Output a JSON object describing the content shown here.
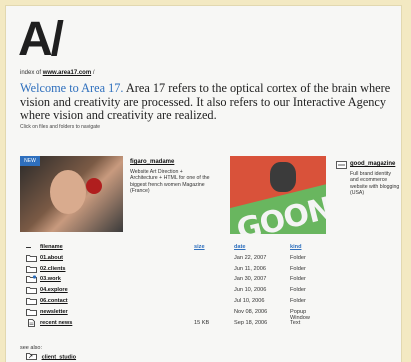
{
  "logo": "A/",
  "index": {
    "prefix": "index of",
    "link": "www.area17.com",
    "suffix": "/"
  },
  "welcome": {
    "highlight": "Welcome to Area 17.",
    "text": " Area 17 refers to the optical cortex of the brain where vision and creativity are processed. It also refers to our Interactive Agency where vision and creativity are realized."
  },
  "hint": "Click on files and folders to navigate",
  "featured": [
    {
      "badge": "NEW",
      "title": "figaro_madame",
      "description": "Website Art Direction + Architecture + HTML for one of the biggest french women Magazine (France)"
    },
    {
      "title": "good_magazine",
      "description": "Full brand identity and ecommerce website with blogging (USA)",
      "image_text": "GOON"
    }
  ],
  "table": {
    "headers": {
      "name": "filename",
      "size": "size",
      "date": "date",
      "kind": "kind"
    },
    "rows": [
      {
        "name": "01.about",
        "size": "",
        "date": "Jan 22, 2007",
        "kind": "Folder",
        "icon": "folder"
      },
      {
        "name": "02.clients",
        "size": "",
        "date": "Jun 11, 2006",
        "kind": "Folder",
        "icon": "folder"
      },
      {
        "name": "03.work",
        "size": "",
        "date": "Jan 30, 2007",
        "kind": "Folder",
        "icon": "folder-badge"
      },
      {
        "name": "04.explore",
        "size": "",
        "date": "Jun 10, 2006",
        "kind": "Folder",
        "icon": "folder"
      },
      {
        "name": "06.contact",
        "size": "",
        "date": "Jul 10, 2006",
        "kind": "Folder",
        "icon": "folder"
      },
      {
        "name": "newsletter",
        "size": "",
        "date": "Nov 08, 2006",
        "kind": "Popup Window",
        "icon": "folder"
      },
      {
        "name": "recent news",
        "size": "15 KB",
        "date": "Sep 18, 2006",
        "kind": "Text",
        "icon": "document"
      }
    ]
  },
  "see_also": "see also:",
  "related": [
    {
      "name": "client_studio",
      "icon": "folder-link"
    }
  ],
  "colors": {
    "accent": "#2e6fbd",
    "page": "#f7f7f5",
    "frame": "#f3e9c2"
  }
}
